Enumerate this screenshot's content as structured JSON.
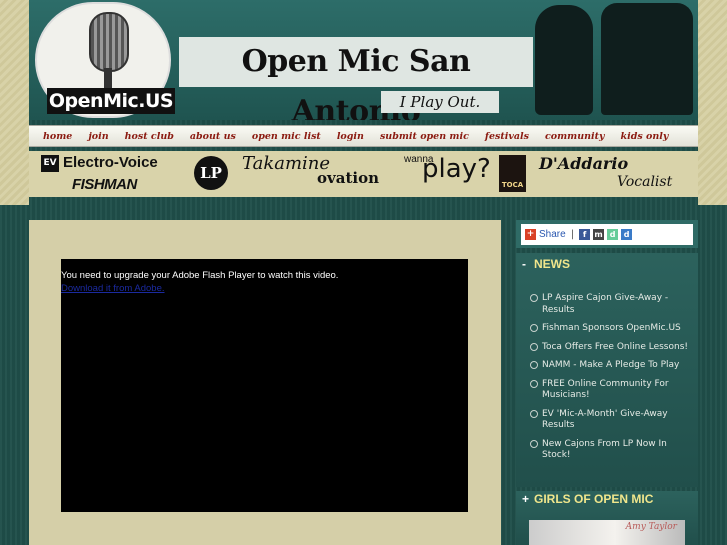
{
  "header": {
    "logo_text": "OpenMic.US",
    "site_title": "Open Mic San Antonio",
    "tagline": "I Play Out."
  },
  "nav": {
    "items": [
      "home",
      "join",
      "host club",
      "about us",
      "open mic list",
      "login",
      "submit open mic",
      "festivals",
      "community",
      "kids only"
    ]
  },
  "sponsors": {
    "ev_badge": "EV",
    "electro_voice": "Electro-Voice",
    "fishman": "FISHMAN",
    "lp": "LP",
    "takamine": "Takamine",
    "ovation": "ovation",
    "wanna": "wanna",
    "play": "play?",
    "toca": "TOCA",
    "daddario": "D'Addario",
    "vocalist": "Vocalist"
  },
  "video": {
    "message": "You need to upgrade your Adobe Flash Player to watch this video.",
    "link": "Download it from Adobe."
  },
  "share": {
    "label": "Share",
    "separator": "|"
  },
  "news": {
    "toggle": "-",
    "title": "NEWS",
    "items": [
      "LP Aspire Cajon Give-Away - Results",
      "Fishman Sponsors OpenMic.US",
      "Toca Offers Free Online Lessons!",
      "NAMM - Make A Pledge To Play",
      "FREE Online Community For Musicians!",
      "EV 'Mic-A-Month' Give-Away Results",
      "New Cajons From LP Now In Stock!"
    ]
  },
  "girls": {
    "toggle": "+",
    "title": "GIRLS OF OPEN MIC",
    "featured_name": "Amy Taylor"
  },
  "colors": {
    "teal": "#1d4a46",
    "nav_text": "#8b1a10",
    "panel_heading": "#f0e68c",
    "sand": "#d5cfa8"
  }
}
